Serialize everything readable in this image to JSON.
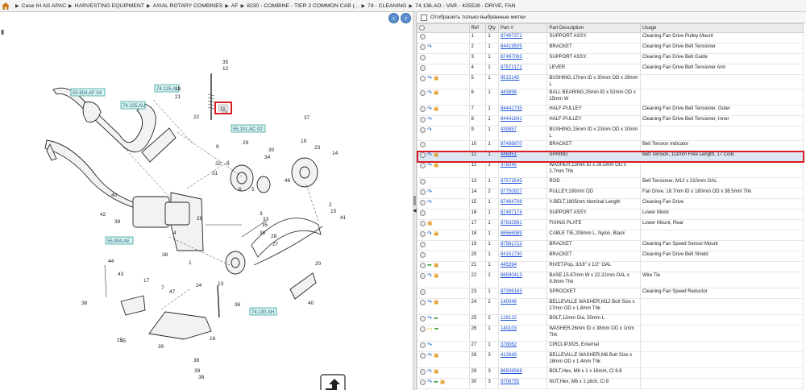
{
  "breadcrumb": [
    "Case IH AG APAC",
    "HARVESTING EQUIPMENT",
    "AXIAL ROTARY COMBINES",
    "AF",
    "8230 - COMBINE - TIER 2 COMMON CAB (...",
    "74 - CLEANING",
    "74.136.AO - VAR - 425528 - DRIVE, FAN"
  ],
  "filter_label": "Отобразить только выбранные метки",
  "columns": [
    "",
    "Ref",
    "Qty",
    "Part #",
    "Part Description",
    "Usage"
  ],
  "diagram": {
    "labels": [
      "55.904.AF 04",
      "74.125.AU",
      "74.125.AU",
      "55.101.AC 02",
      "55.904.AE",
      "74.130.AH"
    ],
    "selected_callout": "11",
    "numbers": [
      "35",
      "12",
      "18",
      "21",
      "22",
      "10",
      "9",
      "32",
      "31",
      "8",
      "29",
      "6",
      "5",
      "30",
      "34",
      "33",
      "35",
      "36",
      "28",
      "27",
      "37",
      "19",
      "23",
      "14",
      "46",
      "2",
      "15",
      "41",
      "42",
      "40",
      "39",
      "38",
      "1",
      "26",
      "4",
      "3",
      "24",
      "13",
      "7",
      "44",
      "43",
      "17",
      "36",
      "38",
      "25",
      "47",
      "45",
      "39",
      "16",
      "38",
      "39",
      "38",
      "20",
      "40"
    ]
  },
  "rows": [
    {
      "ref": "1",
      "qty": "1",
      "part": "87497372",
      "desc": "SUPPORT ASSY.",
      "usage": "Cleaning Fan Drive Pulley Mount",
      "icons": [
        "radio"
      ]
    },
    {
      "ref": "2",
      "qty": "1",
      "part": "84419505",
      "desc": "BRACKET",
      "usage": "Cleaning Fan Drive Belt Tensioner",
      "icons": [
        "radio",
        "info"
      ]
    },
    {
      "ref": "3",
      "qty": "1",
      "part": "87497083",
      "desc": "SUPPORT ASSY.",
      "usage": "Cleaning Fan Drive Belt Guide",
      "icons": [
        "radio"
      ]
    },
    {
      "ref": "4",
      "qty": "1",
      "part": "87572171",
      "desc": "LEVER",
      "usage": "Cleaning Fan Drive Belt Tensioner Arm",
      "icons": [
        "radio"
      ]
    },
    {
      "ref": "5",
      "qty": "1",
      "part": "9515145",
      "desc": "BUSHING,17mm ID x 30mm OD x 29mm L",
      "usage": "",
      "icons": [
        "radio",
        "info",
        "box"
      ]
    },
    {
      "ref": "6",
      "qty": "1",
      "part": "443898",
      "desc": "BALL BEARING,25mm ID x 52mm OD x 15mm W",
      "usage": "",
      "icons": [
        "radio",
        "info",
        "box"
      ],
      "tall": true
    },
    {
      "ref": "7",
      "qty": "1",
      "part": "84441735",
      "desc": "HALF-PULLEY",
      "usage": "Cleaning Fan Drive Belt Tensioner, Outer",
      "icons": [
        "radio",
        "info",
        "box"
      ]
    },
    {
      "ref": "8",
      "qty": "1",
      "part": "84441841",
      "desc": "HALF-PULLEY",
      "usage": "Cleaning Fan Drive Belt Tensioner, Inner",
      "icons": [
        "radio",
        "info"
      ]
    },
    {
      "ref": "9",
      "qty": "1",
      "part": "439857",
      "desc": "BUSHING,15mm ID x 23mm OD x 10mm L",
      "usage": "",
      "icons": [
        "radio",
        "info"
      ]
    },
    {
      "ref": "10",
      "qty": "1",
      "part": "87498870",
      "desc": "BRACKET",
      "usage": "Belt Tension Indicator",
      "icons": [
        "radio"
      ]
    },
    {
      "ref": "11",
      "qty": "1",
      "part": "446851",
      "desc": "SPRING",
      "usage": "Belt Tension, 111mm Free Length, 17 Coils",
      "icons": [
        "radio",
        "info",
        "box"
      ],
      "selected": true
    },
    {
      "ref": "12",
      "qty": "1",
      "part": "378245",
      "desc": "WASHER,13mm ID x 28.5mm OD x 2.7mm Thk",
      "usage": "",
      "icons": [
        "radio",
        "info",
        "box"
      ],
      "tall": true
    },
    {
      "ref": "13",
      "qty": "1",
      "part": "87573545",
      "desc": "ROD",
      "usage": "Belt Tensioner, M12 x 210mm OAL",
      "icons": [
        "radio"
      ]
    },
    {
      "ref": "14",
      "qty": "2",
      "part": "87750927",
      "desc": "PULLEY,180mm OD",
      "usage": "Fan Drive, 18.7mm ID x 180mm OD x 38.5mm Thk",
      "icons": [
        "radio",
        "info"
      ]
    },
    {
      "ref": "15",
      "qty": "1",
      "part": "87484708",
      "desc": "V-BELT,1805mm Nominal Length",
      "usage": "Cleaning Fan Drive",
      "icons": [
        "radio",
        "info"
      ]
    },
    {
      "ref": "16",
      "qty": "1",
      "part": "87497174",
      "desc": "SUPPORT ASSY.",
      "usage": "Lower Motor",
      "icons": [
        "radio"
      ]
    },
    {
      "ref": "17",
      "qty": "1",
      "part": "87632991",
      "desc": "FIXING PLATE",
      "usage": "Lower Mount, Rear",
      "icons": [
        "radio",
        "box"
      ]
    },
    {
      "ref": "18",
      "qty": "1",
      "part": "86566989",
      "desc": "CABLE TIE,208mm L, Nylon, Black",
      "usage": "",
      "icons": [
        "radio",
        "info",
        "box"
      ]
    },
    {
      "ref": "19",
      "qty": "1",
      "part": "87581722",
      "desc": "BRACKET",
      "usage": "Cleaning Fan Speed Sensor Mount",
      "icons": [
        "radio"
      ]
    },
    {
      "ref": "20",
      "qty": "1",
      "part": "84151730",
      "desc": "BRACKET",
      "usage": "Cleaning Fan Drive Belt Shield",
      "icons": [
        "radio"
      ]
    },
    {
      "ref": "21",
      "qty": "1",
      "part": "445394",
      "desc": "RIVET,Pop, 3/16\" x 1/2\" OAL",
      "usage": "",
      "icons": [
        "radio",
        "rep",
        "box"
      ]
    },
    {
      "ref": "22",
      "qty": "1",
      "part": "86590413",
      "desc": "BASE,15.87mm W x 22.22mm OAL x 9.9mm Thk",
      "usage": "Wire Tie",
      "icons": [
        "radio",
        "info",
        "box"
      ],
      "tall": true
    },
    {
      "ref": "23",
      "qty": "1",
      "part": "87399163",
      "desc": "SPROCKET",
      "usage": "Cleaning Fan Speed Reductor",
      "icons": [
        "radio"
      ]
    },
    {
      "ref": "24",
      "qty": "2",
      "part": "140046",
      "desc": "BELLEVILLE WASHER,M12 Bolt Size x 27mm OD x 1.8mm Thk",
      "usage": "",
      "icons": [
        "radio",
        "info",
        "box"
      ],
      "tall": true
    },
    {
      "ref": "25",
      "qty": "2",
      "part": "128122",
      "desc": "BOLT,12mm Dia, 50mm L",
      "usage": "",
      "icons": [
        "radio",
        "info",
        "rep"
      ]
    },
    {
      "ref": "26",
      "qty": "1",
      "part": "140103",
      "desc": "WASHER,26mm ID x 38mm OD x 1mm Thk",
      "usage": "",
      "icons": [
        "radio",
        "note",
        "rep"
      ],
      "tall": true
    },
    {
      "ref": "27",
      "qty": "1",
      "part": "378062",
      "desc": "CIRCLIP,M25, External",
      "usage": "",
      "icons": [
        "radio",
        "info"
      ]
    },
    {
      "ref": "28",
      "qty": "3",
      "part": "412649",
      "desc": "BELLEVILLE WASHER,M6 Bolt Size x 18mm OD x 1.4mm Thk",
      "usage": "",
      "icons": [
        "radio",
        "info",
        "box"
      ],
      "tall": true
    },
    {
      "ref": "29",
      "qty": "3",
      "part": "86508568",
      "desc": "BOLT,Hex, M6 x 1 x 16mm, Cl 8.8",
      "usage": "",
      "icons": [
        "radio",
        "info",
        "box"
      ]
    },
    {
      "ref": "30",
      "qty": "3",
      "part": "9706755",
      "desc": "NUT,Hex, M6 x 1 pitch, Cl 8",
      "usage": "",
      "icons": [
        "radio",
        "info",
        "rep",
        "box"
      ]
    }
  ]
}
